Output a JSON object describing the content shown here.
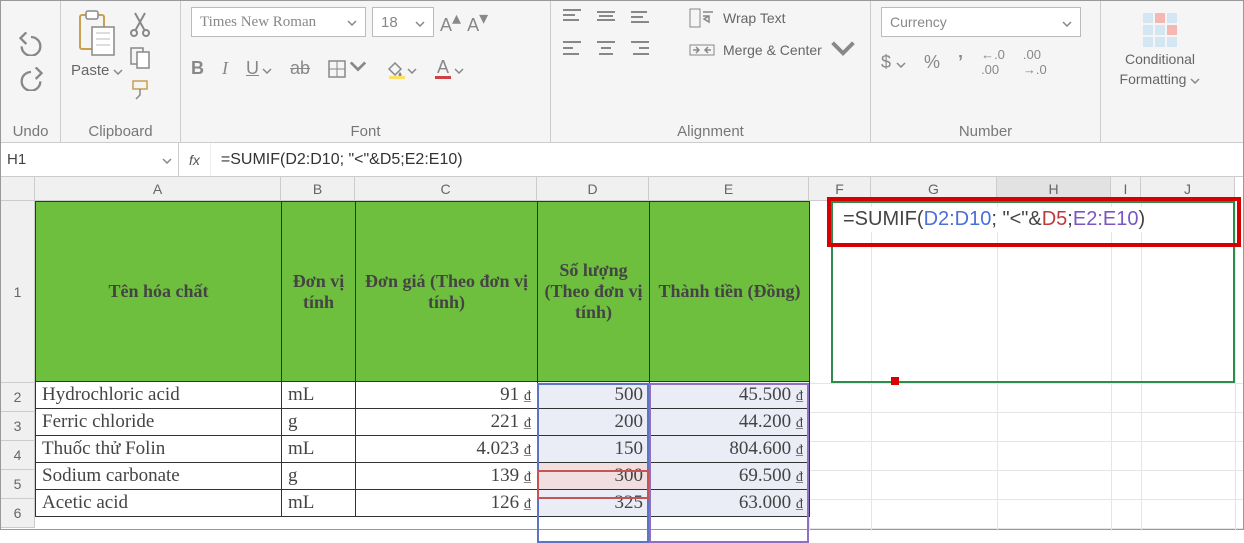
{
  "ribbon": {
    "groups": {
      "undo": "Undo",
      "clipboard": "Clipboard",
      "font": "Font",
      "alignment": "Alignment",
      "number": "Number"
    },
    "paste_label": "Paste",
    "font_name": "Times New Roman",
    "font_size": "18",
    "bold": "B",
    "italic": "I",
    "underline": "U",
    "strike": "ab",
    "fontcolor_letter": "A",
    "increase_font": "A",
    "decrease_font": "A",
    "wrap_text": "Wrap Text",
    "merge_center": "Merge & Center",
    "number_format": "Currency",
    "currency": "$",
    "percent": "%",
    "comma": ",",
    "dec_inc": "⁰₀",
    "dec_dec": "⁰₀",
    "conditional_formatting": "Conditional",
    "conditional_formatting2": "Formatting"
  },
  "formula_bar": {
    "name_box": "H1",
    "fx": "fx",
    "formula": "=SUMIF(D2:D10; \"<\"&D5;E2:E10)"
  },
  "columns": [
    "A",
    "B",
    "C",
    "D",
    "E",
    "F",
    "G",
    "H",
    "I",
    "J"
  ],
  "row_numbers": [
    "1",
    "2",
    "3",
    "4",
    "5",
    "6"
  ],
  "headers": {
    "a": "Tên hóa chất",
    "b": "Đơn vị tính",
    "c": "Đơn giá (Theo đơn vị tính)",
    "d": "Số lượng (Theo đơn vị tính)",
    "e": "Thành tiền (Đồng)"
  },
  "rows": [
    {
      "a": "Hydrochloric acid",
      "b": "mL",
      "c": "91",
      "d": "500",
      "e": "45.500"
    },
    {
      "a": "Ferric chloride",
      "b": "g",
      "c": "221",
      "d": "200",
      "e": "44.200"
    },
    {
      "a": "Thuốc thử Folin",
      "b": "mL",
      "c": "4.023",
      "d": "150",
      "e": "804.600"
    },
    {
      "a": "Sodium carbonate",
      "b": "g",
      "c": "139",
      "d": "300",
      "e": "69.500"
    },
    {
      "a": "Acetic acid",
      "b": "mL",
      "c": "126",
      "d": "325",
      "e": "63.000"
    }
  ],
  "currency_suffix": "₫",
  "formula_overlay": {
    "prefix": "=SUMIF(",
    "range1": "D2:D10",
    "sep1": "; \"<\"&",
    "ref": "D5",
    "sep2": ";",
    "range2": "E2:E10",
    "suffix": ")"
  }
}
